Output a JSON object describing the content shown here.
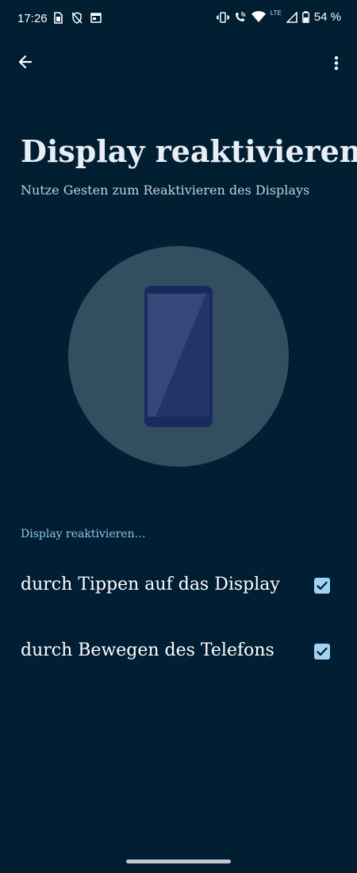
{
  "status_bar": {
    "time": "17:26",
    "network": "LTE",
    "battery": "54 %",
    "left_icons": [
      "sim-icon",
      "shield-off-icon",
      "calendar-icon"
    ],
    "right_icons": [
      "vibrate-icon",
      "wifi-calling-icon",
      "wifi-icon",
      "signal-icon",
      "battery-icon"
    ]
  },
  "app_bar": {
    "back_icon": "arrow-left-icon",
    "menu_icon": "more-vert-icon"
  },
  "header": {
    "title": "Display reaktivieren",
    "subtitle": "Nutze Gesten zum Reaktivieren des Displays"
  },
  "illustration": {
    "icon": "phone-icon",
    "circle_color": "#344e61",
    "phone_color": "#1a2a5c"
  },
  "settings": {
    "section_title": "Display reaktivieren…",
    "items": [
      {
        "label": "durch Tippen auf das Display",
        "checked": true
      },
      {
        "label": "durch Bewegen des Telefons",
        "checked": true
      }
    ]
  },
  "colors": {
    "background": "#011e33",
    "accent": "#8bc8ef",
    "checkbox": "#9fd3f5"
  }
}
